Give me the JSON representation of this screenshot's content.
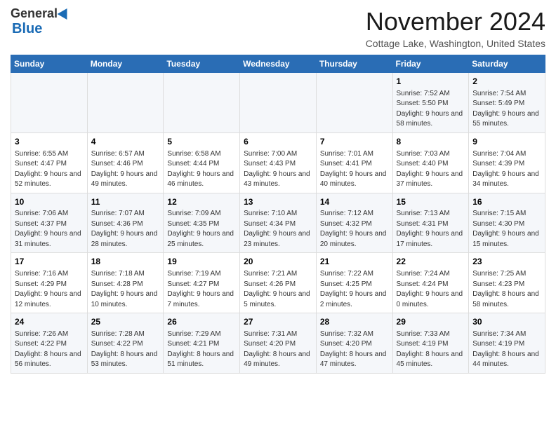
{
  "logo": {
    "line1": "General",
    "line2": "Blue"
  },
  "header": {
    "month": "November 2024",
    "location": "Cottage Lake, Washington, United States"
  },
  "days_of_week": [
    "Sunday",
    "Monday",
    "Tuesday",
    "Wednesday",
    "Thursday",
    "Friday",
    "Saturday"
  ],
  "weeks": [
    [
      {
        "day": "",
        "info": ""
      },
      {
        "day": "",
        "info": ""
      },
      {
        "day": "",
        "info": ""
      },
      {
        "day": "",
        "info": ""
      },
      {
        "day": "",
        "info": ""
      },
      {
        "day": "1",
        "info": "Sunrise: 7:52 AM\nSunset: 5:50 PM\nDaylight: 9 hours\nand 58 minutes."
      },
      {
        "day": "2",
        "info": "Sunrise: 7:54 AM\nSunset: 5:49 PM\nDaylight: 9 hours\nand 55 minutes."
      }
    ],
    [
      {
        "day": "3",
        "info": "Sunrise: 6:55 AM\nSunset: 4:47 PM\nDaylight: 9 hours\nand 52 minutes."
      },
      {
        "day": "4",
        "info": "Sunrise: 6:57 AM\nSunset: 4:46 PM\nDaylight: 9 hours\nand 49 minutes."
      },
      {
        "day": "5",
        "info": "Sunrise: 6:58 AM\nSunset: 4:44 PM\nDaylight: 9 hours\nand 46 minutes."
      },
      {
        "day": "6",
        "info": "Sunrise: 7:00 AM\nSunset: 4:43 PM\nDaylight: 9 hours\nand 43 minutes."
      },
      {
        "day": "7",
        "info": "Sunrise: 7:01 AM\nSunset: 4:41 PM\nDaylight: 9 hours\nand 40 minutes."
      },
      {
        "day": "8",
        "info": "Sunrise: 7:03 AM\nSunset: 4:40 PM\nDaylight: 9 hours\nand 37 minutes."
      },
      {
        "day": "9",
        "info": "Sunrise: 7:04 AM\nSunset: 4:39 PM\nDaylight: 9 hours\nand 34 minutes."
      }
    ],
    [
      {
        "day": "10",
        "info": "Sunrise: 7:06 AM\nSunset: 4:37 PM\nDaylight: 9 hours\nand 31 minutes."
      },
      {
        "day": "11",
        "info": "Sunrise: 7:07 AM\nSunset: 4:36 PM\nDaylight: 9 hours\nand 28 minutes."
      },
      {
        "day": "12",
        "info": "Sunrise: 7:09 AM\nSunset: 4:35 PM\nDaylight: 9 hours\nand 25 minutes."
      },
      {
        "day": "13",
        "info": "Sunrise: 7:10 AM\nSunset: 4:34 PM\nDaylight: 9 hours\nand 23 minutes."
      },
      {
        "day": "14",
        "info": "Sunrise: 7:12 AM\nSunset: 4:32 PM\nDaylight: 9 hours\nand 20 minutes."
      },
      {
        "day": "15",
        "info": "Sunrise: 7:13 AM\nSunset: 4:31 PM\nDaylight: 9 hours\nand 17 minutes."
      },
      {
        "day": "16",
        "info": "Sunrise: 7:15 AM\nSunset: 4:30 PM\nDaylight: 9 hours\nand 15 minutes."
      }
    ],
    [
      {
        "day": "17",
        "info": "Sunrise: 7:16 AM\nSunset: 4:29 PM\nDaylight: 9 hours\nand 12 minutes."
      },
      {
        "day": "18",
        "info": "Sunrise: 7:18 AM\nSunset: 4:28 PM\nDaylight: 9 hours\nand 10 minutes."
      },
      {
        "day": "19",
        "info": "Sunrise: 7:19 AM\nSunset: 4:27 PM\nDaylight: 9 hours\nand 7 minutes."
      },
      {
        "day": "20",
        "info": "Sunrise: 7:21 AM\nSunset: 4:26 PM\nDaylight: 9 hours\nand 5 minutes."
      },
      {
        "day": "21",
        "info": "Sunrise: 7:22 AM\nSunset: 4:25 PM\nDaylight: 9 hours\nand 2 minutes."
      },
      {
        "day": "22",
        "info": "Sunrise: 7:24 AM\nSunset: 4:24 PM\nDaylight: 9 hours\nand 0 minutes."
      },
      {
        "day": "23",
        "info": "Sunrise: 7:25 AM\nSunset: 4:23 PM\nDaylight: 8 hours\nand 58 minutes."
      }
    ],
    [
      {
        "day": "24",
        "info": "Sunrise: 7:26 AM\nSunset: 4:22 PM\nDaylight: 8 hours\nand 56 minutes."
      },
      {
        "day": "25",
        "info": "Sunrise: 7:28 AM\nSunset: 4:22 PM\nDaylight: 8 hours\nand 53 minutes."
      },
      {
        "day": "26",
        "info": "Sunrise: 7:29 AM\nSunset: 4:21 PM\nDaylight: 8 hours\nand 51 minutes."
      },
      {
        "day": "27",
        "info": "Sunrise: 7:31 AM\nSunset: 4:20 PM\nDaylight: 8 hours\nand 49 minutes."
      },
      {
        "day": "28",
        "info": "Sunrise: 7:32 AM\nSunset: 4:20 PM\nDaylight: 8 hours\nand 47 minutes."
      },
      {
        "day": "29",
        "info": "Sunrise: 7:33 AM\nSunset: 4:19 PM\nDaylight: 8 hours\nand 45 minutes."
      },
      {
        "day": "30",
        "info": "Sunrise: 7:34 AM\nSunset: 4:19 PM\nDaylight: 8 hours\nand 44 minutes."
      }
    ]
  ]
}
